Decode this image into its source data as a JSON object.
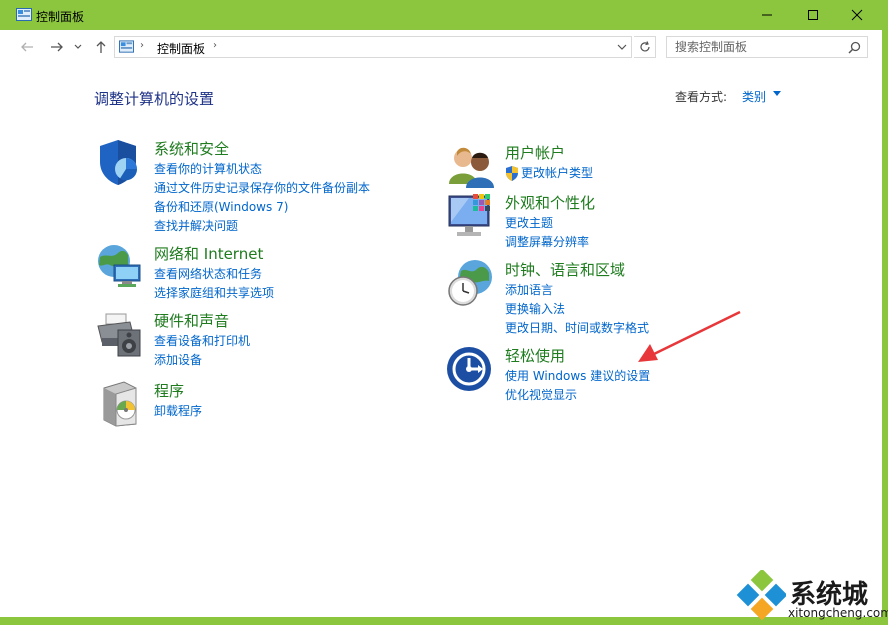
{
  "window": {
    "title": "控制面板"
  },
  "address": {
    "crumb": "控制面板"
  },
  "search": {
    "placeholder": "搜索控制面板"
  },
  "main": {
    "title": "调整计算机的设置",
    "view_by_label": "查看方式:",
    "view_by_value": "类别"
  },
  "categories": [
    {
      "name": "系统和安全",
      "icon": "shield-icon",
      "links": [
        "查看你的计算机状态",
        "通过文件历史记录保存你的文件备份副本",
        "备份和还原(Windows 7)",
        "查找并解决问题"
      ]
    },
    {
      "name": "网络和 Internet",
      "icon": "network-icon",
      "links": [
        "查看网络状态和任务",
        "选择家庭组和共享选项"
      ]
    },
    {
      "name": "硬件和声音",
      "icon": "printer-icon",
      "links": [
        "查看设备和打印机",
        "添加设备"
      ]
    },
    {
      "name": "程序",
      "icon": "programs-icon",
      "links": [
        "卸载程序"
      ]
    },
    {
      "name": "用户帐户",
      "icon": "users-icon",
      "links": [
        "更改帐户类型"
      ]
    },
    {
      "name": "外观和个性化",
      "icon": "monitor-icon",
      "links": [
        "更改主题",
        "调整屏幕分辨率"
      ]
    },
    {
      "name": "时钟、语言和区域",
      "icon": "clock-globe-icon",
      "links": [
        "添加语言",
        "更换输入法",
        "更改日期、时间或数字格式"
      ]
    },
    {
      "name": "轻松使用",
      "icon": "ease-of-access-icon",
      "links": [
        "使用 Windows 建议的设置",
        "优化视觉显示"
      ]
    }
  ],
  "watermark": {
    "text": "系统城",
    "url": "xitongcheng.com"
  },
  "colors": {
    "titlebar": "#8cc63f",
    "link": "#0066cc",
    "heading": "#1e7b1e",
    "title": "#1e3287",
    "annotation": "#e8373a"
  }
}
